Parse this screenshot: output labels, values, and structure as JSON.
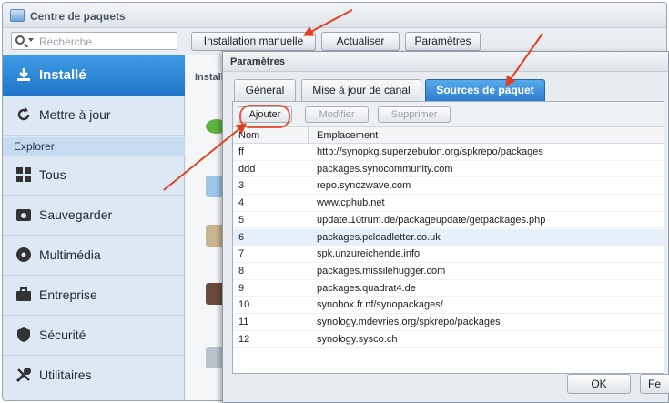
{
  "window": {
    "title": "Centre de paquets"
  },
  "toolbar": {
    "search_placeholder": "Recherche",
    "manual_install": "Installation manuelle",
    "refresh": "Actualiser",
    "settings": "Paramètres"
  },
  "sidebar": {
    "active": "Installé",
    "update": "Mettre à jour",
    "section": "Explorer",
    "items": [
      "Tous",
      "Sauvegarder",
      "Multimédia",
      "Entreprise",
      "Sécurité",
      "Utilitaires"
    ]
  },
  "content": {
    "header": "Install"
  },
  "dialog": {
    "title": "Paramètres",
    "tabs": [
      "Général",
      "Mise à jour de canal",
      "Sources de paquet"
    ],
    "buttons": {
      "add": "Ajouter",
      "edit": "Modifier",
      "delete": "Supprimer"
    },
    "columns": {
      "name": "Nom",
      "location": "Emplacement"
    },
    "rows": [
      {
        "name": "ff",
        "location": "http://synopkg.superzebulon.org/spkrepo/packages"
      },
      {
        "name": "ddd",
        "location": "packages.synocommunity.com"
      },
      {
        "name": "3",
        "location": "repo.synozwave.com"
      },
      {
        "name": "4",
        "location": "www.cphub.net"
      },
      {
        "name": "5",
        "location": "update.10trum.de/packageupdate/getpackages.php"
      },
      {
        "name": "6",
        "location": "packages.pcloadletter.co.uk"
      },
      {
        "name": "7",
        "location": "spk.unzureichende.info"
      },
      {
        "name": "8",
        "location": "packages.missilehugger.com"
      },
      {
        "name": "9",
        "location": "packages.quadrat4.de"
      },
      {
        "name": "10",
        "location": "synobox.fr.nf/synopackages/"
      },
      {
        "name": "11",
        "location": "synology.mdevries.org/spkrepo/packages"
      },
      {
        "name": "12",
        "location": "synology.sysco.ch"
      }
    ],
    "ok": "OK",
    "cancel": "Fe"
  },
  "colors": {
    "accent": "#2d7fcf",
    "annotation": "#e0401f",
    "sidebar_bg": "#dce9f5"
  }
}
